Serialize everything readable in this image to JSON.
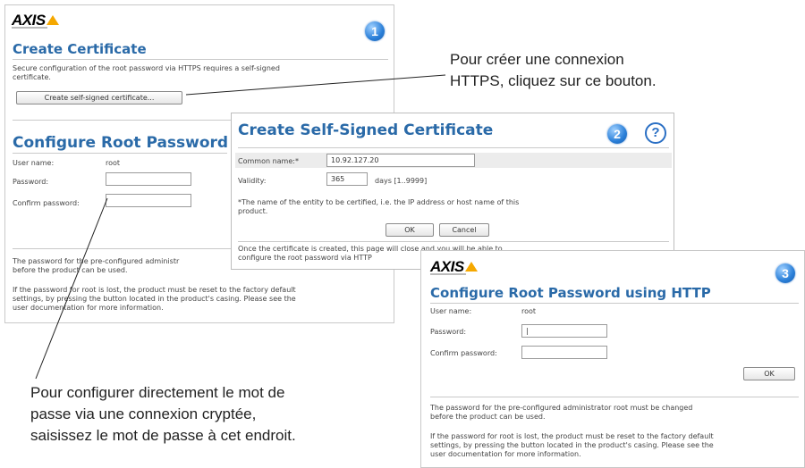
{
  "callouts": {
    "top_line1": "Pour créer une connexion",
    "top_line2": "HTTPS, cliquez sur ce bouton.",
    "bottom_line1": "Pour configurer directement le mot de",
    "bottom_line2": "passe via une connexion cryptée,",
    "bottom_line3": "saisissez le mot de passe à cet endroit."
  },
  "panel1": {
    "logo": "AXIS",
    "badge": "1",
    "title": "Create Certificate",
    "description_line1": "Secure configuration of the root password via HTTPS requires a self-signed",
    "description_line2": "certificate.",
    "create_button": "Create self-signed certificate...",
    "section_title": "Configure Root Password",
    "user_label": "User name:",
    "user_value": "root",
    "password_label": "Password:",
    "confirm_label": "Confirm password:",
    "note1_line1": "The password for the pre-configured administr",
    "note1_line2": "before the product can be used.",
    "note2_line1": "If the password for root is lost, the product must be reset to the factory default",
    "note2_line2": "settings, by pressing the button located in the product's casing. Please see the",
    "note2_line3": "user documentation for more information."
  },
  "panel2": {
    "title": "Create Self-Signed Certificate",
    "badge": "2",
    "help": "?",
    "common_name_label": "Common name:*",
    "common_name_value": "10.92.127.20",
    "validity_label": "Validity:",
    "validity_value": "365",
    "validity_unit": "days [1..9999]",
    "footnote_line1": "*The name of the entity to be certified, i.e. the IP address or host name of this",
    "footnote_line2": "product.",
    "ok": "OK",
    "cancel": "Cancel",
    "info_line1": "Once the certificate is created, this page will close and you will be able to",
    "info_line2": "configure the root password via HTTP"
  },
  "panel3": {
    "logo": "AXIS",
    "badge": "3",
    "title": "Configure Root Password using HTTP",
    "user_label": "User name:",
    "user_value": "root",
    "password_label": "Password:",
    "password_value": "|",
    "confirm_label": "Confirm password:",
    "ok": "OK",
    "note1_line1": "The password for the pre-configured administrator root must be changed",
    "note1_line2": "before the product can be used.",
    "note2_line1": "If the password for root is lost, the product must be reset to the factory default",
    "note2_line2": "settings, by pressing the button located in the product's casing. Please see the",
    "note2_line3": "user documentation for more information."
  }
}
